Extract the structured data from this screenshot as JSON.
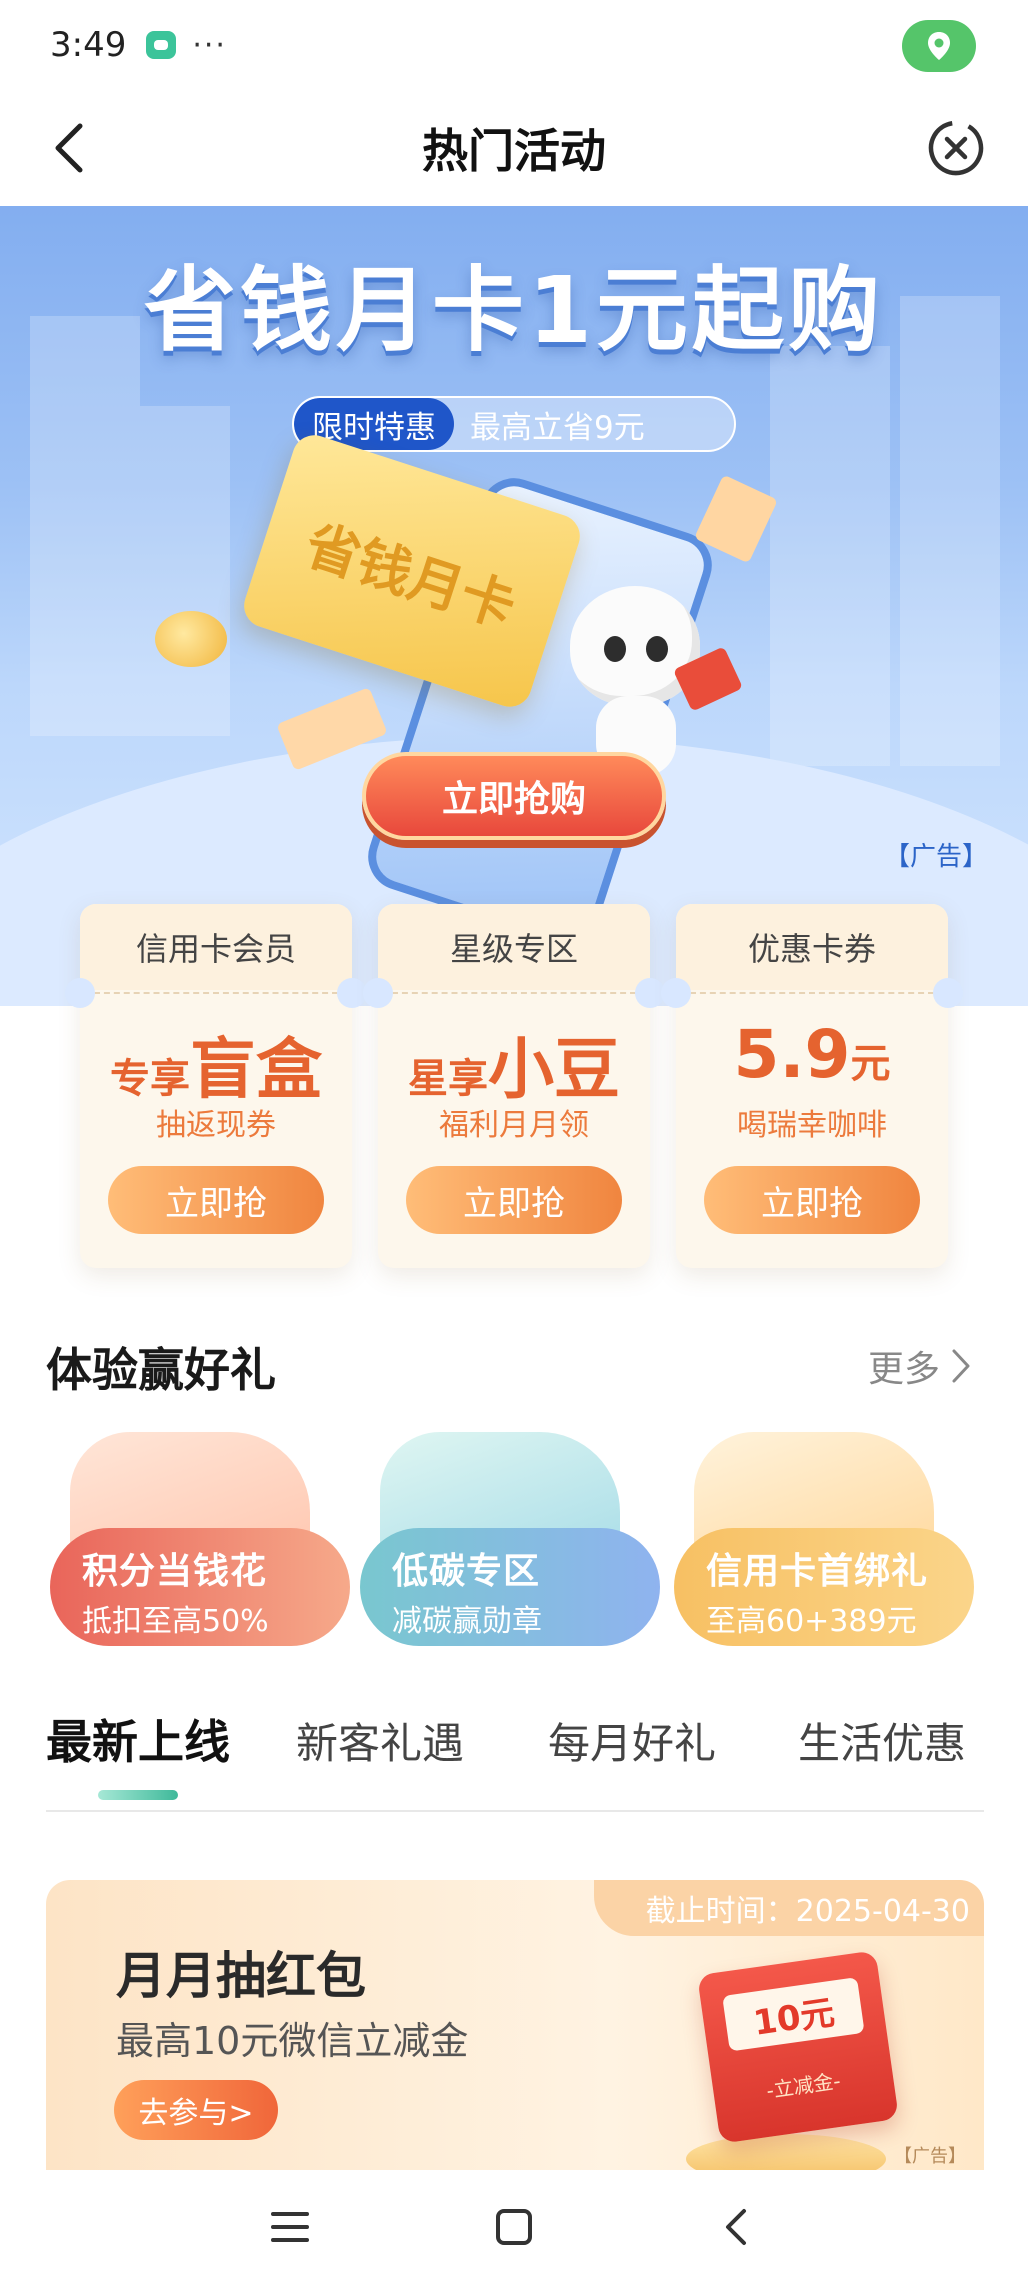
{
  "status_bar": {
    "time": "3:49",
    "dots": "···"
  },
  "nav": {
    "title": "热门活动"
  },
  "hero": {
    "title": "省钱月卡1元起购",
    "subtitle_tag": "限时特惠",
    "subtitle_text": "最高立省9元",
    "card_text": "省钱月卡",
    "button": "立即抢购",
    "ad_label": "【广告】"
  },
  "promo_cards": [
    {
      "header": "信用卡会员",
      "main_small": "专享",
      "main_big": "盲盒",
      "sub": "抽返现券",
      "button": "立即抢"
    },
    {
      "header": "星级专区",
      "main_small": "星享",
      "main_big": "小豆",
      "sub": "福利月月领",
      "button": "立即抢"
    },
    {
      "header": "优惠卡券",
      "main_small": "元",
      "main_big": "5.9",
      "sub": "喝瑞幸咖啡",
      "button": "立即抢"
    }
  ],
  "experience": {
    "title": "体验赢好礼",
    "more": "更多",
    "items": [
      {
        "title": "积分当钱花",
        "sub": "抵扣至高50%"
      },
      {
        "title": "低碳专区",
        "sub": "减碳赢勋章"
      },
      {
        "title": "信用卡首绑礼",
        "sub": "至高60+389元"
      }
    ]
  },
  "tabs": [
    {
      "label": "最新上线"
    },
    {
      "label": "新客礼遇"
    },
    {
      "label": "每月好礼"
    },
    {
      "label": "生活优惠"
    }
  ],
  "activity": {
    "deadline": "截止时间：2025-04-30",
    "title": "月月抽红包",
    "subtitle": "最高10元微信立减金",
    "button": "去参与>",
    "envelope_amount": "10元",
    "envelope_label": "-立减金-",
    "ad_label": "【广告】"
  },
  "colors": {
    "accent_orange": "#f0853f",
    "brand_blue": "#1f56c9",
    "tab_indicator": "#3fb99a",
    "status_location": "#55c56a"
  }
}
